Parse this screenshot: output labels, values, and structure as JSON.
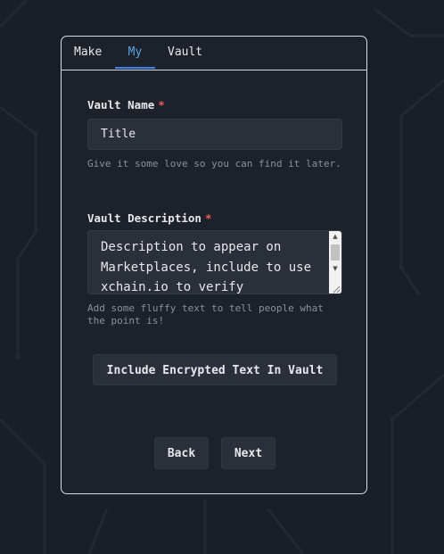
{
  "tabs": [
    {
      "label": "Make"
    },
    {
      "label": "My"
    },
    {
      "label": "Vault"
    }
  ],
  "active_tab": "My",
  "vault_name": {
    "label": "Vault Name",
    "required_mark": "*",
    "value": "Title",
    "hint": "Give it some love so you can find it later."
  },
  "vault_description": {
    "label": "Vault Description",
    "required_mark": "*",
    "value": "Description to appear on Marketplaces, include to use xchain.io to verify",
    "hint": "Add some fluffy text to tell people what the point is!"
  },
  "buttons": {
    "encrypt_label": "Include Encrypted Text In Vault",
    "back_label": "Back",
    "next_label": "Next"
  },
  "colors": {
    "background": "#1a1e27",
    "panel": "#1d212a",
    "input_bg": "#2a2f39",
    "accent": "#3b82f6",
    "required": "#ef5b5b",
    "hint": "#8a909b"
  },
  "icons": [
    "scroll-up-arrow-icon",
    "scroll-down-arrow-icon",
    "resize-grip-icon"
  ]
}
